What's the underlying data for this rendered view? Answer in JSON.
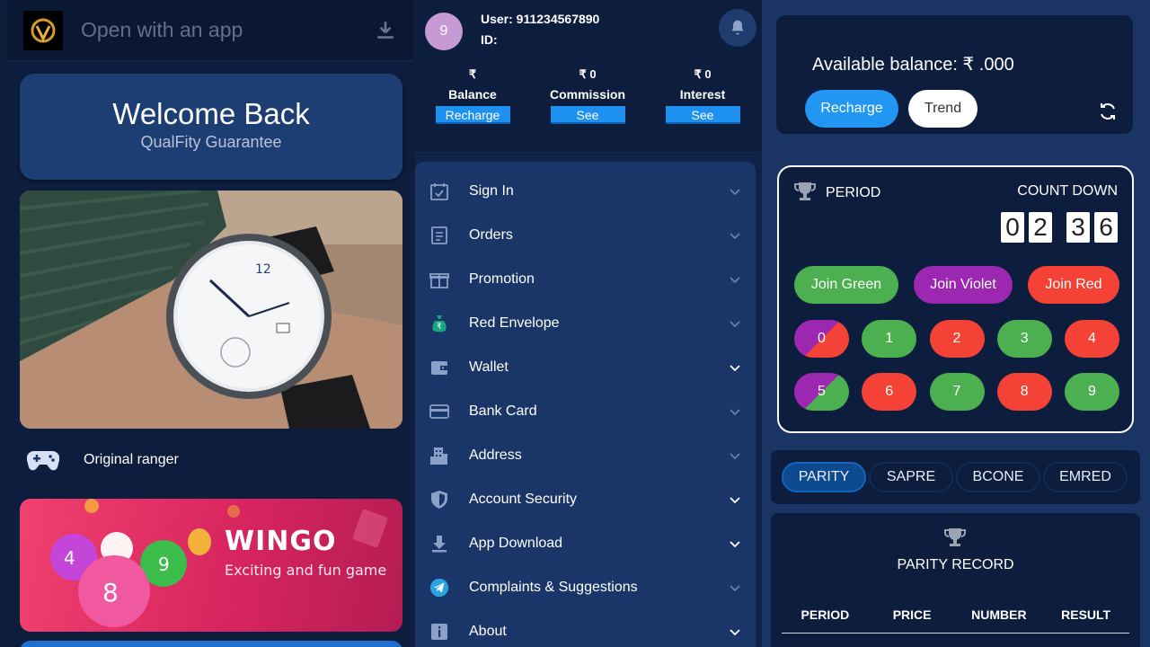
{
  "left": {
    "app_banner": {
      "text": "Open with an app"
    },
    "welcome": {
      "title": "Welcome Back",
      "subtitle": "QualFity Guarantee"
    },
    "section_label": "Original ranger",
    "wingo": {
      "title": "WINGO",
      "subtitle": "Exciting and fun game"
    }
  },
  "user": {
    "avatar_initial": "9",
    "user_line": "User:  911234567890",
    "id_line": "ID:",
    "stats": [
      {
        "value": "₹",
        "label": "Balance",
        "button": "Recharge"
      },
      {
        "value": "₹ 0",
        "label": "Commission",
        "button": "See"
      },
      {
        "value": "₹ 0",
        "label": "Interest",
        "button": "See"
      }
    ]
  },
  "menu": [
    {
      "label": "Sign In",
      "icon": "calendar-check-icon"
    },
    {
      "label": "Orders",
      "icon": "list-icon"
    },
    {
      "label": "Promotion",
      "icon": "gift-icon"
    },
    {
      "label": "Red Envelope",
      "icon": "money-bag-icon"
    },
    {
      "label": "Wallet",
      "icon": "wallet-icon"
    },
    {
      "label": "Bank Card",
      "icon": "credit-card-icon"
    },
    {
      "label": "Address",
      "icon": "building-icon"
    },
    {
      "label": "Account Security",
      "icon": "shield-icon"
    },
    {
      "label": "App Download",
      "icon": "download-icon"
    },
    {
      "label": "Complaints & Suggestions",
      "icon": "telegram-icon"
    },
    {
      "label": "About",
      "icon": "info-icon"
    }
  ],
  "balance": {
    "text": "Available balance: ₹ .000",
    "recharge": "Recharge",
    "trend": "Trend"
  },
  "game": {
    "period_label": "PERIOD",
    "countdown_label": "COUNT DOWN",
    "digits": [
      "0",
      "2",
      "3",
      "6"
    ],
    "join": [
      "Join Green",
      "Join Violet",
      "Join Red"
    ],
    "numbers": [
      "0",
      "1",
      "2",
      "3",
      "4",
      "5",
      "6",
      "7",
      "8",
      "9"
    ]
  },
  "tabs": [
    "PARITY",
    "SAPRE",
    "BCONE",
    "EMRED"
  ],
  "record": {
    "title": "PARITY RECORD",
    "columns": [
      "PERIOD",
      "PRICE",
      "NUMBER",
      "RESULT"
    ]
  },
  "colors": {
    "green": "#4caf50",
    "violet": "#9c27b0",
    "red": "#f44336",
    "accent_blue": "#2196f3"
  }
}
